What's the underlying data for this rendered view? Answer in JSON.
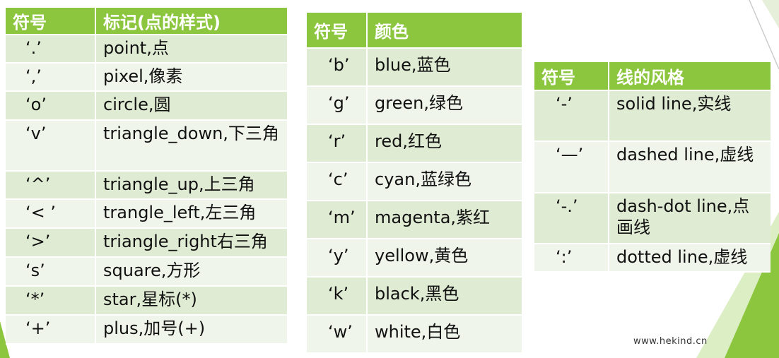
{
  "colors": {
    "header_bg": "#8cc63f",
    "row_dark": "#dfebd3",
    "row_light": "#eff5ea",
    "accent": "#8cc63f"
  },
  "markers_table": {
    "headers": [
      "符号",
      "标记(点的样式)"
    ],
    "rows": [
      [
        "‘.’",
        "point,点"
      ],
      [
        "‘,’",
        "pixel,像素"
      ],
      [
        "‘o’",
        "circle,圆"
      ],
      [
        "‘v’",
        "triangle_down,下三角"
      ],
      [
        "‘^’",
        "triangle_up,上三角"
      ],
      [
        "‘<  ’",
        "trangle_left,左三角"
      ],
      [
        "‘>’",
        "triangle_right右三角"
      ],
      [
        "‘s’",
        "square,方形"
      ],
      [
        "‘*’",
        "star,星标(*)"
      ],
      [
        "‘+’",
        "plus,加号(+)"
      ]
    ]
  },
  "colors_table": {
    "headers": [
      "符号",
      "颜色"
    ],
    "rows": [
      [
        "‘b’",
        "blue,蓝色"
      ],
      [
        "‘g’",
        "green,绿色"
      ],
      [
        "‘r’",
        "red,红色"
      ],
      [
        "‘c’",
        "cyan,蓝绿色"
      ],
      [
        "‘m’",
        "magenta,紫红"
      ],
      [
        "‘y’",
        "yellow,黄色"
      ],
      [
        "‘k’",
        "black,黑色"
      ],
      [
        "‘w’",
        "white,白色"
      ]
    ]
  },
  "linestyle_table": {
    "headers": [
      "符号",
      "线的风格"
    ],
    "rows": [
      [
        "‘-’",
        "solid line,实线"
      ],
      [
        "‘—’",
        "dashed line,虚线"
      ],
      [
        "‘-.’",
        "dash-dot line,点画线"
      ],
      [
        "‘:’",
        "dotted line,虚线"
      ]
    ]
  },
  "watermark": "www.hekind.cn"
}
